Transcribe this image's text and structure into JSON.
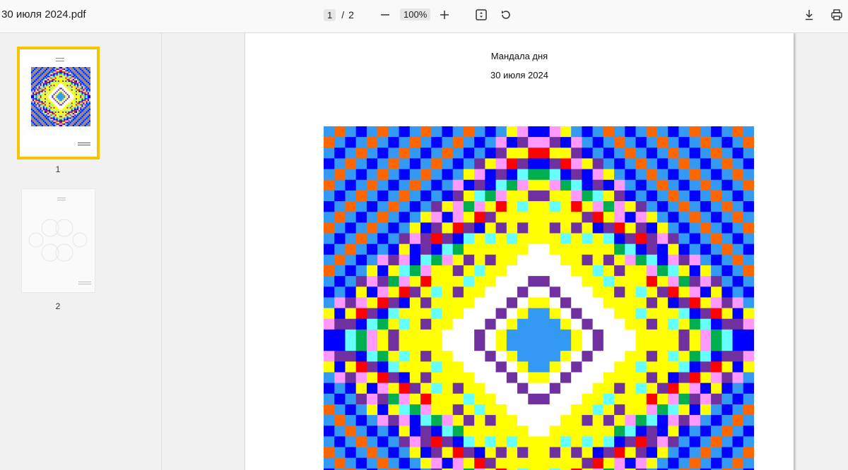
{
  "toolbar": {
    "title": "30 июля 2024.pdf",
    "page_current": "1",
    "page_separator": "/",
    "page_total": "2",
    "zoom": "100%",
    "icons": [
      "zoom-out-icon",
      "zoom-in-icon",
      "fit-page-icon",
      "rotate-icon",
      "download-icon",
      "print-icon"
    ]
  },
  "sidebar": {
    "thumbnails": [
      {
        "label": "1",
        "selected": true
      },
      {
        "label": "2",
        "selected": false
      }
    ],
    "selected_color": "#f7c400"
  },
  "page": {
    "heading": "Мандала дня",
    "date": "30 июля 2024"
  },
  "mandala": {
    "palette": {
      "blue": "#0000ff",
      "sky": "#3399f3",
      "orange": "#ff6600",
      "pink": "#ff99ff",
      "purple": "#7030a0",
      "yellow": "#ffff00",
      "cyan": "#66ffff",
      "red": "#ff0000",
      "green": "#00b050",
      "white": "#ffffff"
    }
  }
}
